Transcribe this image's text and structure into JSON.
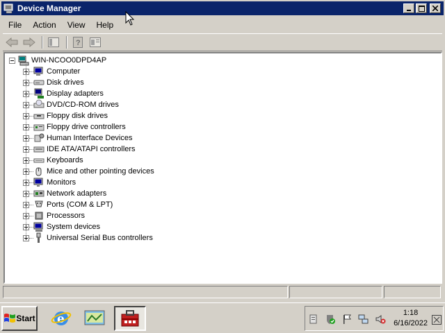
{
  "window": {
    "title": "Device Manager",
    "buttons": {
      "minimize": "_",
      "maximize": "□",
      "close": "✕"
    }
  },
  "menu": [
    {
      "label": "File"
    },
    {
      "label": "Action"
    },
    {
      "label": "View"
    },
    {
      "label": "Help"
    }
  ],
  "toolbar": {
    "icons": [
      "back-icon",
      "forward-icon",
      "show-hide-console-tree-icon",
      "help-icon",
      "properties-icon"
    ]
  },
  "tree": {
    "root": "WIN-NCOO0DPD4AP",
    "items": [
      {
        "label": "Computer",
        "icon": "computer-icon"
      },
      {
        "label": "Disk drives",
        "icon": "disk-drive-icon"
      },
      {
        "label": "Display adapters",
        "icon": "display-adapter-icon"
      },
      {
        "label": "DVD/CD-ROM drives",
        "icon": "dvd-drive-icon"
      },
      {
        "label": "Floppy disk drives",
        "icon": "floppy-disk-icon"
      },
      {
        "label": "Floppy drive controllers",
        "icon": "floppy-controller-icon"
      },
      {
        "label": "Human Interface Devices",
        "icon": "hid-icon"
      },
      {
        "label": "IDE ATA/ATAPI controllers",
        "icon": "ide-controller-icon"
      },
      {
        "label": "Keyboards",
        "icon": "keyboard-icon"
      },
      {
        "label": "Mice and other pointing devices",
        "icon": "mouse-icon"
      },
      {
        "label": "Monitors",
        "icon": "monitor-icon"
      },
      {
        "label": "Network adapters",
        "icon": "network-adapter-icon"
      },
      {
        "label": "Ports (COM & LPT)",
        "icon": "port-icon"
      },
      {
        "label": "Processors",
        "icon": "processor-icon"
      },
      {
        "label": "System devices",
        "icon": "system-device-icon"
      },
      {
        "label": "Universal Serial Bus controllers",
        "icon": "usb-icon"
      }
    ]
  },
  "taskbar": {
    "start_label": "Start",
    "clock_time": "1:18",
    "clock_date": "6/16/2022"
  },
  "colors": {
    "titlebar": "#0a246a",
    "face": "#d4d0c8"
  }
}
